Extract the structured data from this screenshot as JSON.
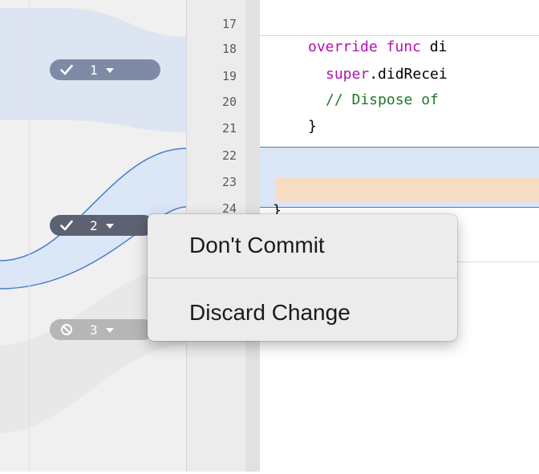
{
  "gutter": {
    "line_numbers": [
      "17",
      "18",
      "19",
      "20",
      "21",
      "22",
      "23",
      "24"
    ]
  },
  "code": {
    "line18": {
      "keyword": "override func ",
      "text": "di"
    },
    "line19": {
      "keyword": "super",
      "text": ".didRecei"
    },
    "line20": {
      "comment": "// Dispose of "
    },
    "line21": {
      "text": "}"
    },
    "line24": {
      "text": "}"
    }
  },
  "badges": [
    {
      "number": "1",
      "icon": "checkmark-icon",
      "state": "accepted"
    },
    {
      "number": "2",
      "icon": "checkmark-icon",
      "state": "accepted"
    },
    {
      "number": "3",
      "icon": "no-entry-icon",
      "state": "discarded"
    }
  ],
  "menu": {
    "items": [
      {
        "label": "Don't Commit"
      },
      {
        "label": "Discard Change"
      }
    ]
  },
  "colors": {
    "keyword": "#b30fb0",
    "comment": "#1f7a2a",
    "selection": "#dbe6f6",
    "selection_border": "#4a7bd0",
    "change_highlight": "#f6dcc2"
  }
}
